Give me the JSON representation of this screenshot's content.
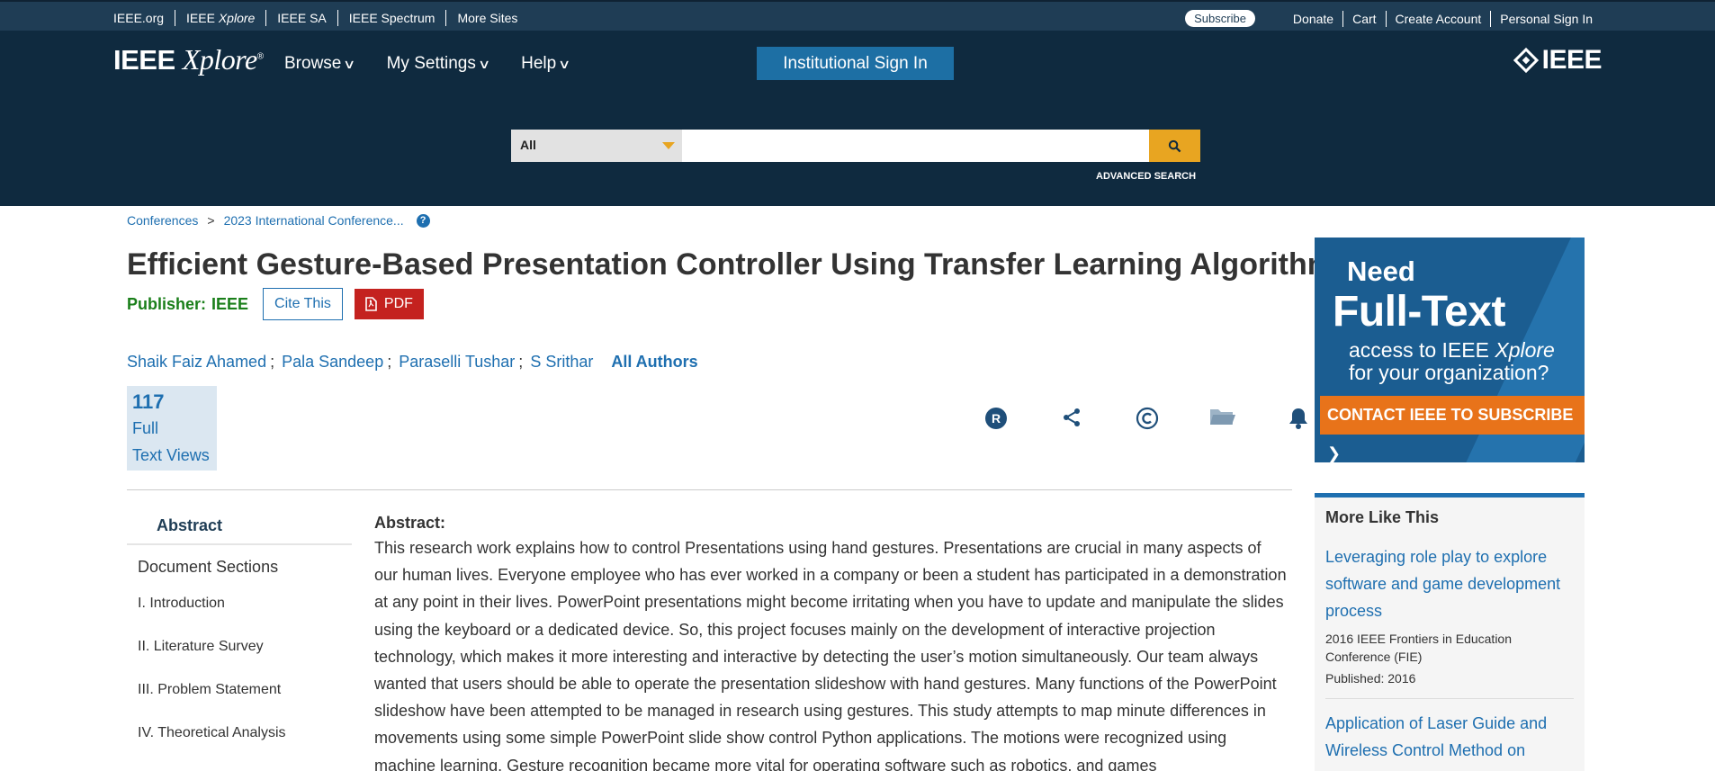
{
  "topbar": {
    "links": [
      "IEEE.org",
      "IEEE Xplore",
      "IEEE SA",
      "IEEE Spectrum",
      "More Sites"
    ],
    "subscribe": "Subscribe",
    "right_links": [
      "Donate",
      "Cart",
      "Create Account",
      "Personal Sign In"
    ]
  },
  "header": {
    "logo_ieee": "IEEE",
    "logo_xplore": "Xplore",
    "logo_reg": "®",
    "nav": [
      "Browse",
      "My Settings",
      "Help"
    ],
    "institutional": "Institutional Sign In",
    "brand": "IEEE"
  },
  "search": {
    "scope": "All",
    "value": "",
    "advanced": "ADVANCED SEARCH"
  },
  "breadcrumb": {
    "items": [
      "Conferences",
      "2023 International Conference..."
    ],
    "separator": ">"
  },
  "article": {
    "title": "Efficient Gesture-Based Presentation Controller Using Transfer Learning Algorithm",
    "publisher_label": "Publisher:",
    "publisher": "IEEE",
    "cite": "Cite This",
    "pdf": "PDF",
    "authors": [
      "Shaik Faiz Ahamed",
      "Pala Sandeep",
      "Paraselli Tushar",
      "S Srithar"
    ],
    "all_authors": "All Authors",
    "metric_value": "117",
    "metric_label_1": "Full",
    "metric_label_2": "Text Views"
  },
  "tools": [
    "rights-icon",
    "share-icon",
    "copyright-icon",
    "folder-icon",
    "alert-bell-icon"
  ],
  "sidebar": {
    "active": "Abstract",
    "heading": "Document Sections",
    "sections": [
      "I.  Introduction",
      "II.  Literature Survey",
      "III.  Problem Statement",
      "IV.  Theoretical Analysis"
    ]
  },
  "abstract": {
    "heading": "Abstract:",
    "text": "This research work explains how to control Presentations using hand gestures. Presentations are crucial in many aspects of our human lives. Everyone employee who has ever worked in a company or been a student has participated in a demonstration at any point in their lives. PowerPoint presentations might become irritating when you have to update and manipulate the slides using the keyboard or a dedicated device. So, this project focuses mainly on the development of interactive projection technology, which makes it more interesting and interactive by detecting the user’s motion simultaneously. Our team always wanted that users should be able to operate the presentation slideshow with hand gestures. Many functions of the PowerPoint slideshow have been attempted to be managed in research using gestures. This study attempts to map minute differences in movements using some simple PowerPoint slide show control Python applications. The motions were recognized using machine learning. Gesture recognition became more vital for operating software such as robotics, and games"
  },
  "ad": {
    "line1": "Need",
    "line2": "Full-Text",
    "line3a": "access to IEEE ",
    "line3b": "Xplore",
    "line4": "for your organization?",
    "cta": "CONTACT IEEE TO SUBSCRIBE"
  },
  "more_like_this": {
    "heading": "More Like This",
    "items": [
      {
        "title": "Leveraging role play to explore software and game development process",
        "venue": "2016 IEEE Frontiers in Education Conference (FIE)",
        "published": "Published: 2016"
      },
      {
        "title": "Application of Laser Guide and Wireless Control Method on"
      }
    ]
  },
  "colors": {
    "topbar": "#1f3d55",
    "header": "#0f2a3f",
    "link": "#1e6fb0",
    "publisher": "#1a7f1a",
    "pdf": "#c4221f",
    "search_button": "#e8a521",
    "cta": "#e8731a"
  }
}
